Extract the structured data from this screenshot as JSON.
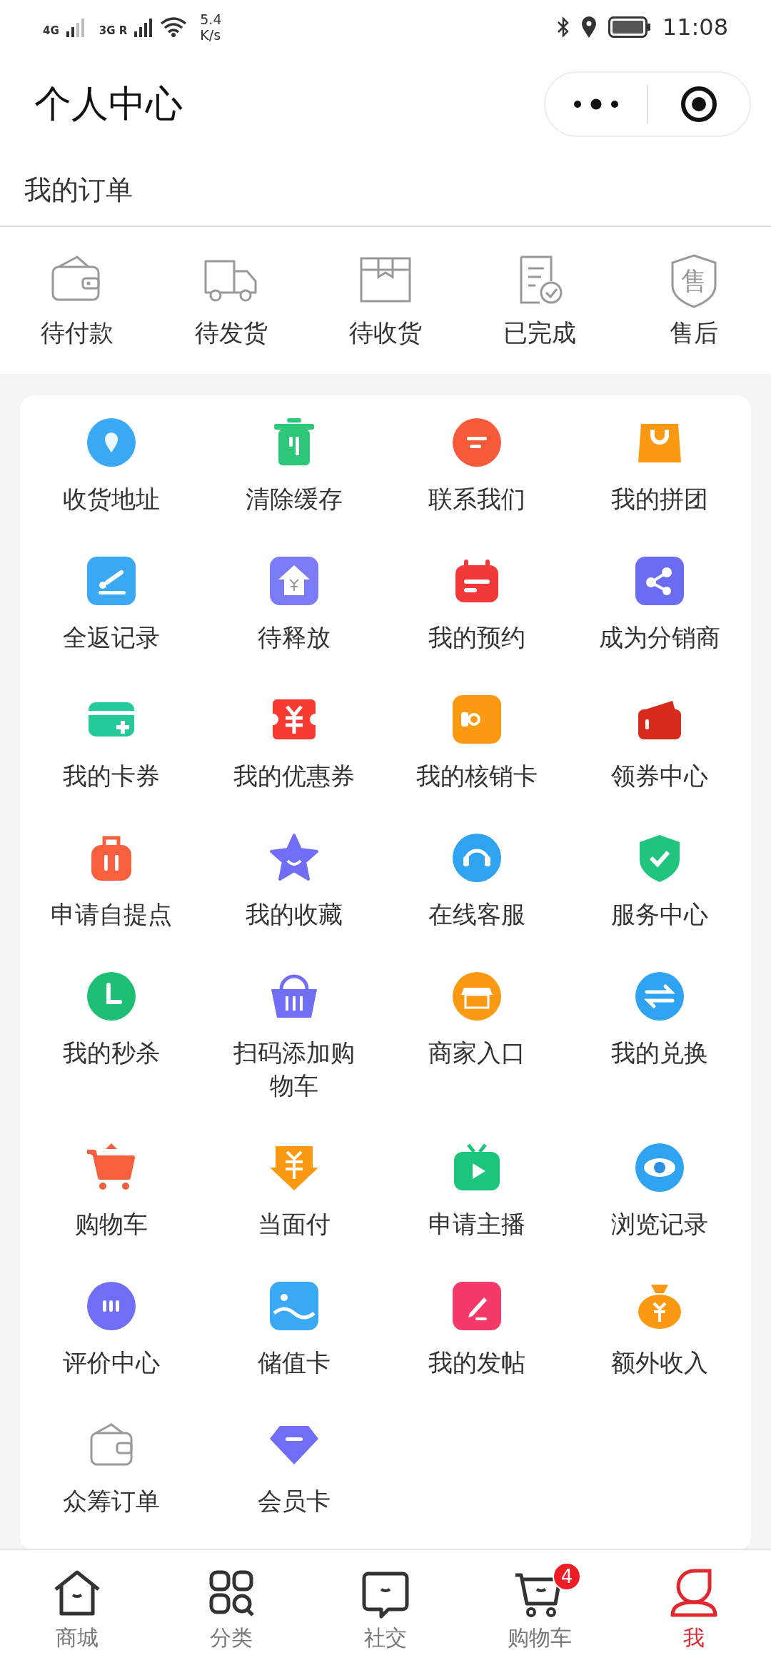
{
  "status_bar": {
    "signal_1": "4G",
    "signal_2": "3G R",
    "speed": "5.4",
    "speed_unit": "K/s",
    "time": "11:08"
  },
  "header": {
    "title": "个人中心"
  },
  "orders": {
    "title": "我的订单",
    "items": [
      {
        "label": "待付款"
      },
      {
        "label": "待发货"
      },
      {
        "label": "待收货"
      },
      {
        "label": "已完成"
      },
      {
        "label": "售后",
        "icon_text": "售"
      }
    ]
  },
  "services": [
    {
      "label": "收货地址",
      "color": "#3aa8f5"
    },
    {
      "label": "清除缓存",
      "color": "#2ec77a"
    },
    {
      "label": "联系我们",
      "color": "#f75a3a"
    },
    {
      "label": "我的拼团",
      "color": "#fb9a12"
    },
    {
      "label": "全返记录",
      "color": "#3aa8f5"
    },
    {
      "label": "待释放",
      "color": "#7b7cf5"
    },
    {
      "label": "我的预约",
      "color": "#f2393a"
    },
    {
      "label": "成为分销商",
      "color": "#6a6cf2"
    },
    {
      "label": "我的卡券",
      "color": "#26c99a"
    },
    {
      "label": "我的优惠券",
      "color": "#f53a32"
    },
    {
      "label": "我的核销卡",
      "color": "#fb9a12"
    },
    {
      "label": "领券中心",
      "color": "#d62a1c"
    },
    {
      "label": "申请自提点",
      "color": "#f7603e"
    },
    {
      "label": "我的收藏",
      "color": "#6f6ef5"
    },
    {
      "label": "在线客服",
      "color": "#2fa3f0"
    },
    {
      "label": "服务中心",
      "color": "#20c47c"
    },
    {
      "label": "我的秒杀",
      "color": "#1dbf75"
    },
    {
      "label": "扫码添加购物车",
      "color": "#6f6ef5"
    },
    {
      "label": "商家入口",
      "color": "#fb9a12"
    },
    {
      "label": "我的兑换",
      "color": "#2fa3f0"
    },
    {
      "label": "购物车",
      "color": "#f7603e"
    },
    {
      "label": "当面付",
      "color": "#fb9a12"
    },
    {
      "label": "申请主播",
      "color": "#1dc47c"
    },
    {
      "label": "浏览记录",
      "color": "#2fa3f0"
    },
    {
      "label": "评价中心",
      "color": "#6f6ef5"
    },
    {
      "label": "储值卡",
      "color": "#3aa8f5"
    },
    {
      "label": "我的发帖",
      "color": "#f53a6a"
    },
    {
      "label": "额外收入",
      "color": "#fb9a12"
    },
    {
      "label": "众筹订单",
      "color": "#9a9a9a"
    },
    {
      "label": "会员卡",
      "color": "#6f6ef5"
    }
  ],
  "tab_bar": [
    {
      "label": "商城",
      "selected": false
    },
    {
      "label": "分类",
      "selected": false
    },
    {
      "label": "社交",
      "selected": false
    },
    {
      "label": "购物车",
      "selected": false,
      "badge": "4"
    },
    {
      "label": "我",
      "selected": true
    }
  ]
}
